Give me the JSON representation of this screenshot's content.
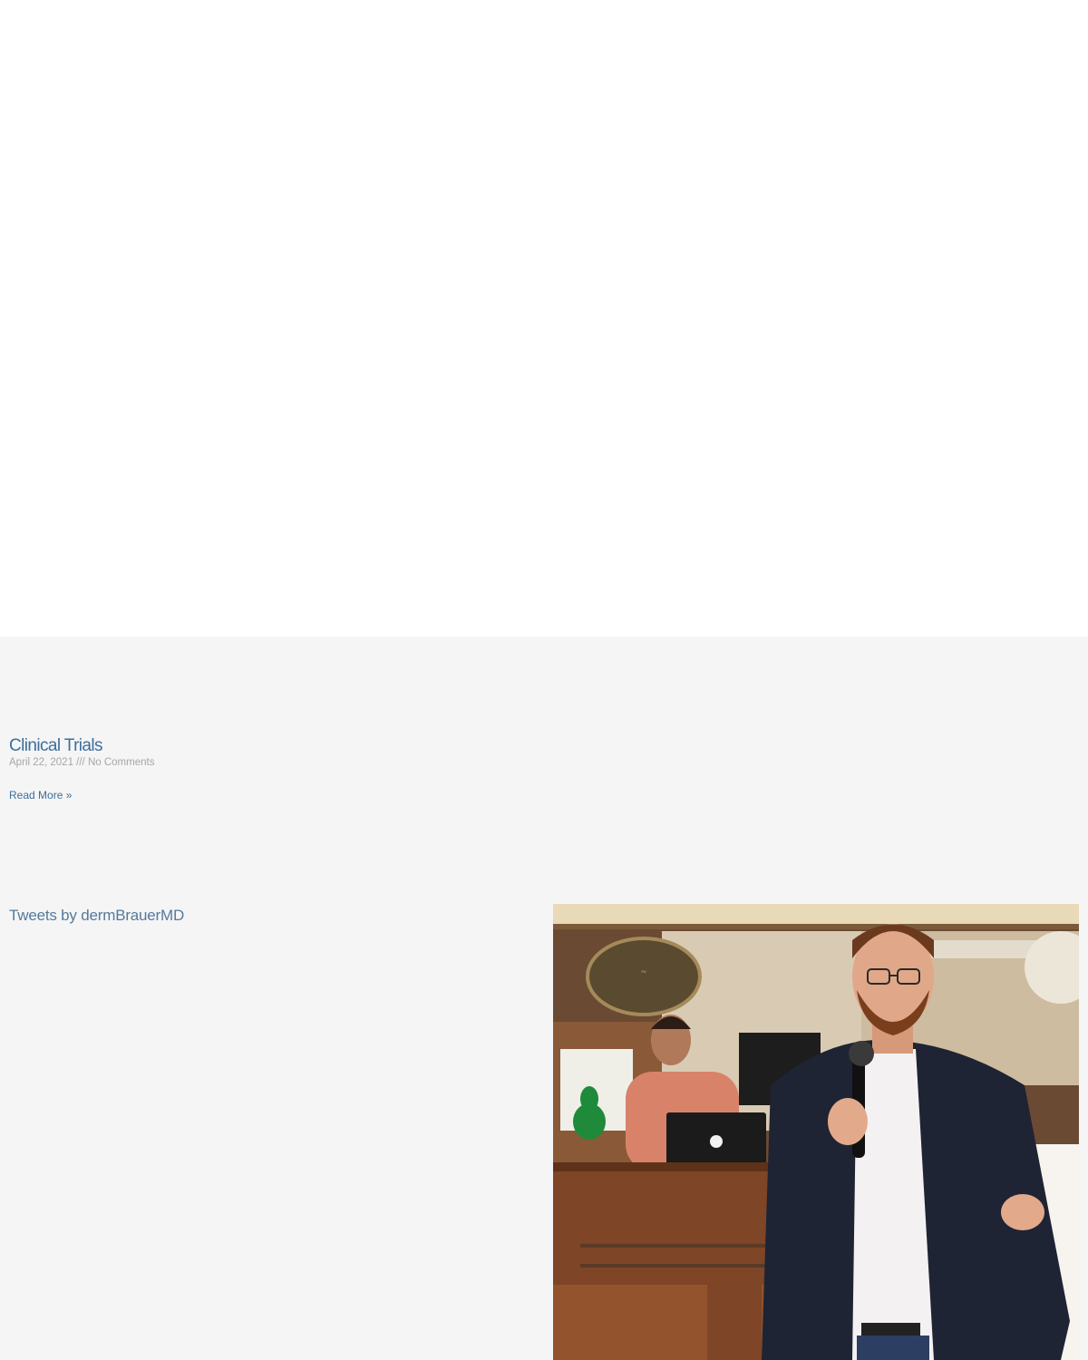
{
  "post": {
    "title": "Clinical Trials",
    "date": "April 22, 2021",
    "separator": " /// ",
    "comments": "No Comments",
    "read_more": "Read More »"
  },
  "twitter": {
    "link_text": "Tweets by dermBrauerMD"
  },
  "photo": {
    "subject": "speaker-with-microphone-photo"
  },
  "colors": {
    "link": "#3d6e9c",
    "meta": "#a6a6a6",
    "section_bg": "#f5f5f5"
  }
}
